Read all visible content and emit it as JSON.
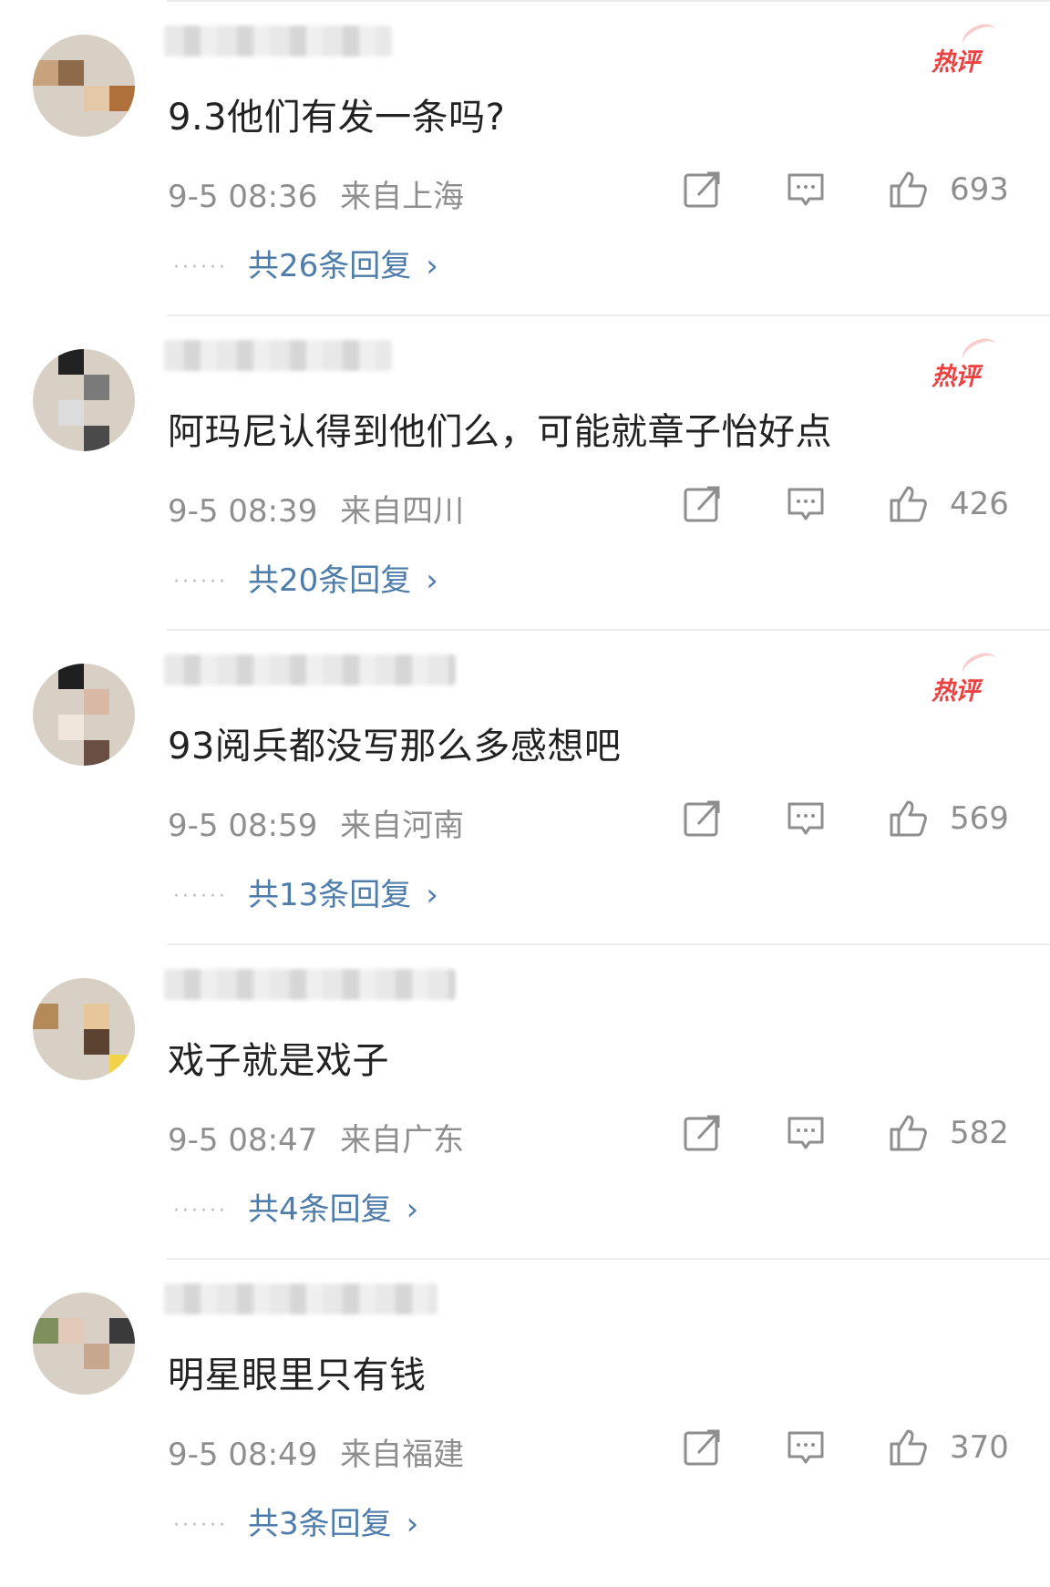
{
  "hot_label": "热评",
  "comments": [
    {
      "text": "9.3他们有发一条吗?",
      "time": "9-5 08:36",
      "location": "来自上海",
      "likes": "693",
      "replies": "共26条回复",
      "is_hot": true,
      "avatar_colors": [
        "#c7a27d",
        "#8c6a4a",
        "#e4c9a8",
        "#b0703c"
      ]
    },
    {
      "text": "阿玛尼认得到他们么，可能就章子怡好点",
      "time": "9-5 08:39",
      "location": "来自四川",
      "likes": "426",
      "replies": "共20条回复",
      "is_hot": true,
      "avatar_colors": [
        "#222222",
        "#7a7a7a",
        "#dcdcdc",
        "#4a4a4a"
      ]
    },
    {
      "text": "93阅兵都没写那么多感想吧",
      "time": "9-5 08:59",
      "location": "来自河南",
      "likes": "569",
      "replies": "共13条回复",
      "is_hot": true,
      "avatar_colors": [
        "#1f1f1f",
        "#d9b9a6",
        "#f1e6dc",
        "#6a4e43"
      ]
    },
    {
      "text": "戏子就是戏子",
      "time": "9-5 08:47",
      "location": "来自广东",
      "likes": "582",
      "replies": "共4条回复",
      "is_hot": false,
      "avatar_colors": [
        "#b58a5a",
        "#e7c79a",
        "#5a4330",
        "#f1d34a"
      ]
    },
    {
      "text": "明星眼里只有钱",
      "time": "9-5 08:49",
      "location": "来自福建",
      "likes": "370",
      "replies": "共3条回复",
      "is_hot": false,
      "avatar_colors": [
        "#7d8f5a",
        "#e3c9b8",
        "#3a3a3a",
        "#c8a78f"
      ]
    }
  ]
}
